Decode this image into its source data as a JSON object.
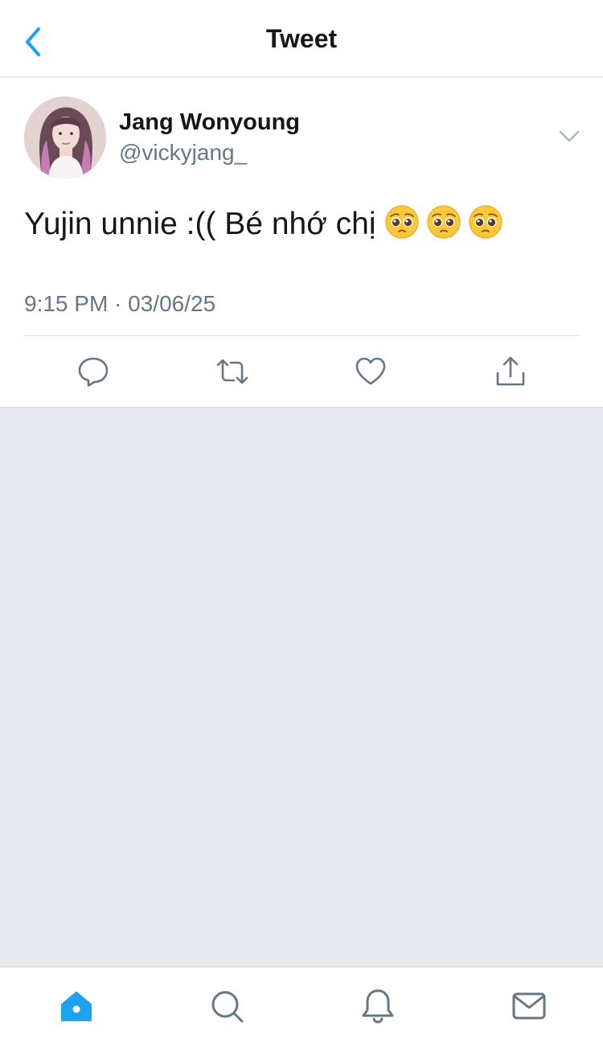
{
  "header": {
    "title": "Tweet",
    "back_icon": "chevron-left-icon"
  },
  "tweet": {
    "author_name": "Jang Wonyoung",
    "author_handle": "@vickyjang_",
    "text": "Yujin unnie :(( Bé nhớ chị",
    "emojis": [
      "pleading-face-emoji",
      "pleading-face-emoji",
      "pleading-face-emoji"
    ],
    "timestamp": "9:15 PM · 03/06/25",
    "actions": [
      "reply-icon",
      "retweet-icon",
      "like-icon",
      "share-icon"
    ]
  },
  "tabbar": {
    "tabs": [
      "home-icon",
      "search-icon",
      "notifications-icon",
      "messages-icon"
    ],
    "active": "home-icon"
  },
  "colors": {
    "accent": "#1da1f2",
    "icon_gray": "#657786",
    "text": "#14171a",
    "background": "#e6e9ed"
  }
}
